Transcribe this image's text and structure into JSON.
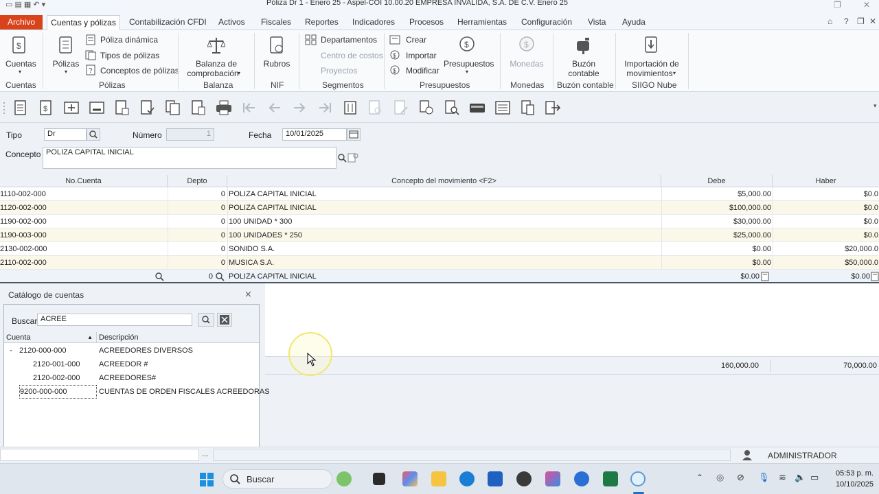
{
  "window": {
    "title": "Póliza Dr     1 - Enero 25  -  Aspel-COI 10.00.20 EMPRESA INVALIDA, S.A. DE C.V. Enero 25"
  },
  "menu": {
    "archivo": "Archivo",
    "items": [
      "Cuentas y pólizas",
      "Contabilización CFDI",
      "Activos",
      "Fiscales",
      "Reportes",
      "Indicadores",
      "Procesos",
      "Herramientas",
      "Configuración",
      "Vista",
      "Ayuda"
    ]
  },
  "ribbon": {
    "cuentas": "Cuentas",
    "polizas": "Pólizas",
    "poliza_dinamica": "Póliza dinámica",
    "tipos_polizas": "Tipos de pólizas",
    "conceptos_polizas": "Conceptos de pólizas",
    "balanza_1": "Balanza de",
    "balanza_2": "comprobación",
    "rubros": "Rubros",
    "departamentos": "Departamentos",
    "centro_costos": "Centro de costos",
    "proyectos": "Proyectos",
    "crear": "Crear",
    "importar": "Importar",
    "modificar": "Modificar",
    "presupuestos": "Presupuestos",
    "monedas": "Monedas",
    "buzon_1": "Buzón",
    "buzon_2": "contable",
    "importacion_1": "Importación de",
    "importacion_2": "movimientos",
    "groups": [
      "Cuentas",
      "Pólizas",
      "Balanza",
      "NIF",
      "Segmentos",
      "Presupuestos",
      "Monedas",
      "Buzón contable",
      "SIIGO Nube"
    ]
  },
  "form": {
    "tipo_label": "Tipo",
    "tipo_value": "Dr",
    "numero_label": "Número",
    "numero_value": "1",
    "fecha_label": "Fecha",
    "fecha_value": "10/01/2025",
    "concepto_label": "Concepto",
    "concepto_value": "POLIZA CAPITAL INICIAL"
  },
  "grid": {
    "headers": [
      "No.Cuenta",
      "Depto",
      "Concepto del movimiento <F2>",
      "Debe",
      "Haber"
    ],
    "rows": [
      {
        "cuenta": "1110-002-000",
        "depto": "0",
        "concepto": "POLIZA CAPITAL INICIAL",
        "debe": "$5,000.00",
        "haber": "$0.0"
      },
      {
        "cuenta": "1120-002-000",
        "depto": "0",
        "concepto": "POLIZA CAPITAL INICIAL",
        "debe": "$100,000.00",
        "haber": "$0.0"
      },
      {
        "cuenta": "1190-002-000",
        "depto": "0",
        "concepto": "100 UNIDAD * 300",
        "debe": "$30,000.00",
        "haber": "$0.0"
      },
      {
        "cuenta": "1190-003-000",
        "depto": "0",
        "concepto": "100 UNIDADES * 250",
        "debe": "$25,000.00",
        "haber": "$0.0"
      },
      {
        "cuenta": "2130-002-000",
        "depto": "0",
        "concepto": "SONIDO S.A.",
        "debe": "$0.00",
        "haber": "$20,000.0"
      },
      {
        "cuenta": "2110-002-000",
        "depto": "0",
        "concepto": "MUSICA S.A.",
        "debe": "$0.00",
        "haber": "$50,000.0"
      }
    ],
    "edit_row": {
      "depto": "0",
      "concepto": "POLIZA CAPITAL INICIAL",
      "debe": "$0.00",
      "haber": "$0.00"
    },
    "total_debe": "160,000.00",
    "total_haber": "70,000.00"
  },
  "catalog": {
    "title": "Catálogo de cuentas",
    "buscar_label": "Buscar",
    "search_value": "ACREE",
    "col_cuenta": "Cuenta",
    "col_descripcion": "Descripción",
    "rows": [
      {
        "cuenta": "2120-000-000",
        "descripcion": "ACREEDORES DIVERSOS"
      },
      {
        "cuenta": "2120-001-000",
        "descripcion": "ACREEDOR #"
      },
      {
        "cuenta": "2120-002-000",
        "descripcion": "ACREEDORES#"
      },
      {
        "cuenta": "9200-000-000",
        "descripcion": "CUENTAS DE ORDEN FISCALES ACREEDORAS"
      }
    ]
  },
  "status": {
    "ellipsis": "...",
    "user": "ADMINISTRADOR"
  },
  "taskbar": {
    "search": "Buscar",
    "time": "05:53 p. m.",
    "date": "10/10/2025"
  }
}
